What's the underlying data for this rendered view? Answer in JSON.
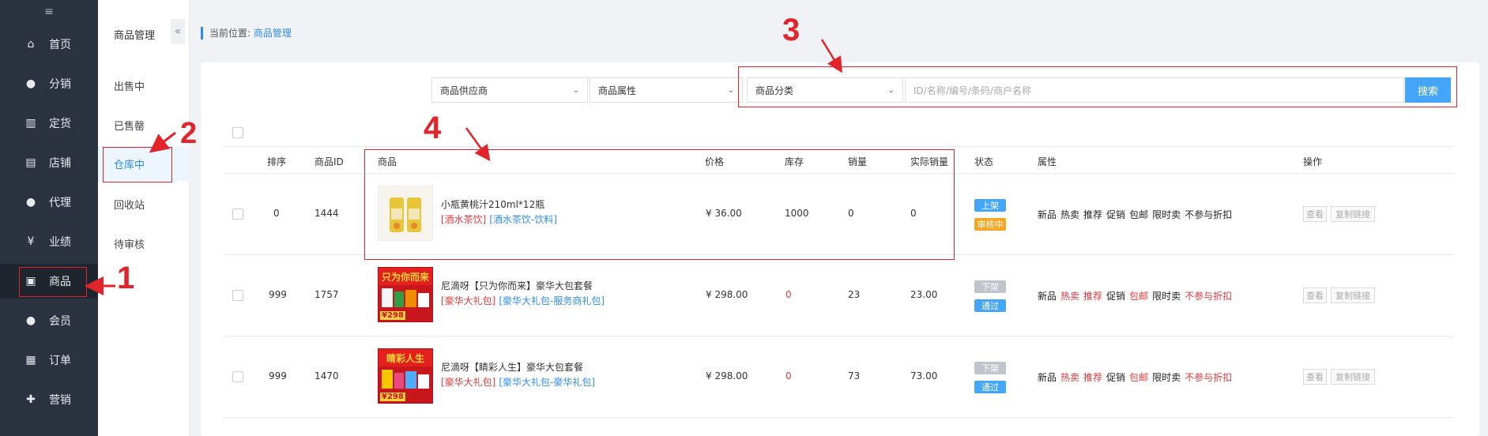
{
  "nav": {
    "items": [
      {
        "label": "首页",
        "icon": "home-icon"
      },
      {
        "label": "分销",
        "icon": "user-icon"
      },
      {
        "label": "定货",
        "icon": "bar-chart-icon"
      },
      {
        "label": "店铺",
        "icon": "store-icon"
      },
      {
        "label": "代理",
        "icon": "user-icon"
      },
      {
        "label": "业绩",
        "icon": "yen-icon"
      },
      {
        "label": "商品",
        "icon": "bag-icon"
      },
      {
        "label": "会员",
        "icon": "user-icon"
      },
      {
        "label": "订单",
        "icon": "document-icon"
      },
      {
        "label": "营销",
        "icon": "gift-icon"
      }
    ]
  },
  "subnav": {
    "title": "商品管理",
    "items": [
      "出售中",
      "已售罄",
      "仓库中",
      "回收站",
      "待审核"
    ],
    "active_index": 2
  },
  "breadcrumb": {
    "prefix": "当前位置:",
    "current": "商品管理"
  },
  "filters": {
    "supplier": "商品供应商",
    "attribute": "商品属性",
    "category": "商品分类",
    "search_placeholder": "ID/名称/编号/条码/商户名称",
    "search_button": "搜索"
  },
  "table": {
    "headers": [
      "排序",
      "商品ID",
      "商品",
      "价格",
      "库存",
      "销量",
      "实际销量",
      "状态",
      "属性",
      "操作"
    ],
    "rows": [
      {
        "sort": "0",
        "id": "1444",
        "name": "小瓶黄桃汁210ml*12瓶",
        "cat1": "[酒水茶饮]",
        "cat2": "[酒水茶饮-饮料]",
        "price": "¥ 36.00",
        "stock": "1000",
        "stock_zero": false,
        "sales": "0",
        "actual_sales": "0",
        "status1": "上架",
        "status2": "审核中",
        "attrs": [
          {
            "t": "新品",
            "on": false
          },
          {
            "t": "热卖",
            "on": false
          },
          {
            "t": "推荐",
            "on": false
          },
          {
            "t": "促销",
            "on": false
          },
          {
            "t": "包邮",
            "on": false
          },
          {
            "t": "限时卖",
            "on": false
          },
          {
            "t": "不参与折扣",
            "on": false
          }
        ]
      },
      {
        "sort": "999",
        "id": "1757",
        "name": "尼滴呀【只为你而来】豪华大包套餐",
        "cat1": "[豪华大礼包]",
        "cat2": "[豪华大礼包-服务商礼包]",
        "price": "¥ 298.00",
        "stock": "0",
        "stock_zero": true,
        "sales": "23",
        "actual_sales": "23.00",
        "status1": "下架",
        "status2": "通过",
        "thumb_title": "只为你而来",
        "thumb_price": "¥298",
        "attrs": [
          {
            "t": "新品",
            "on": false
          },
          {
            "t": "热卖",
            "on": true
          },
          {
            "t": "推荐",
            "on": true
          },
          {
            "t": "促销",
            "on": false
          },
          {
            "t": "包邮",
            "on": true
          },
          {
            "t": "限时卖",
            "on": false
          },
          {
            "t": "不参与折扣",
            "on": true
          }
        ]
      },
      {
        "sort": "999",
        "id": "1470",
        "name": "尼滴呀【睛彩人生】豪华大包套餐",
        "cat1": "[豪华大礼包]",
        "cat2": "[豪华大礼包-豪华礼包]",
        "price": "¥ 298.00",
        "stock": "0",
        "stock_zero": true,
        "sales": "73",
        "actual_sales": "73.00",
        "status1": "下架",
        "status2": "通过",
        "thumb_title": "睛彩人生",
        "thumb_price": "¥298",
        "attrs": [
          {
            "t": "新品",
            "on": false
          },
          {
            "t": "热卖",
            "on": true
          },
          {
            "t": "推荐",
            "on": true
          },
          {
            "t": "促销",
            "on": false
          },
          {
            "t": "包邮",
            "on": true
          },
          {
            "t": "限时卖",
            "on": false
          },
          {
            "t": "不参与折扣",
            "on": true
          }
        ]
      }
    ],
    "ops": [
      "查看",
      "复制链接"
    ]
  },
  "annotations": [
    "1",
    "2",
    "3",
    "4"
  ],
  "colors": {
    "accent": "#2d8cf0",
    "annotation": "#e2242b",
    "on_shelf": "#45a5f8",
    "reviewing": "#f5a623",
    "off_shelf": "#c0c4cc",
    "passed": "#45a5f8"
  }
}
